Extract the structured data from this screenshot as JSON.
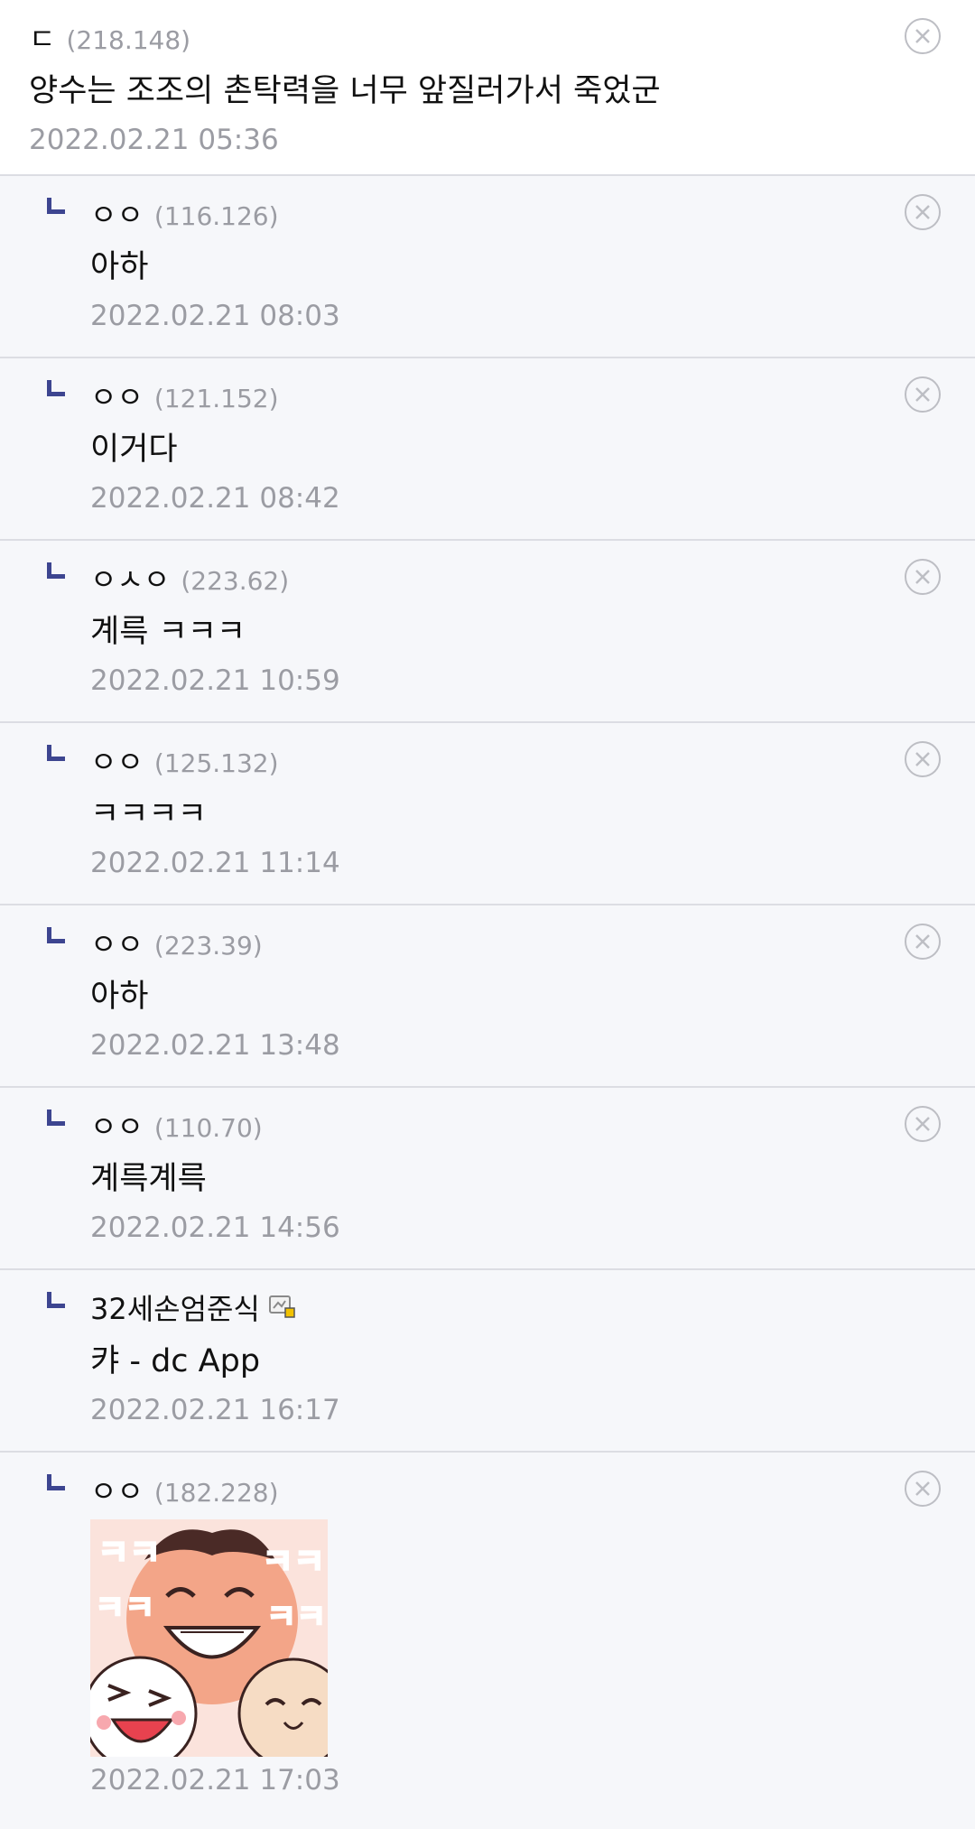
{
  "comments": [
    {
      "nick": "ㄷ",
      "ip": "(218.148)",
      "text": "양수는 조조의 촌탁력을 너무 앞질러가서 죽었군",
      "date": "2022.02.21 05:36"
    },
    {
      "nick": "ㅇㅇ",
      "ip": "(116.126)",
      "text": "아하",
      "date": "2022.02.21 08:03"
    },
    {
      "nick": "ㅇㅇ",
      "ip": "(121.152)",
      "text": "이거다",
      "date": "2022.02.21 08:42"
    },
    {
      "nick": "ㅇㅅㅇ",
      "ip": "(223.62)",
      "text": "계륵 ㅋㅋㅋ",
      "date": "2022.02.21 10:59"
    },
    {
      "nick": "ㅇㅇ",
      "ip": "(125.132)",
      "text": "ㅋㅋㅋㅋ",
      "date": "2022.02.21 11:14"
    },
    {
      "nick": "ㅇㅇ",
      "ip": "(223.39)",
      "text": "아하",
      "date": "2022.02.21 13:48"
    },
    {
      "nick": "ㅇㅇ",
      "ip": "(110.70)",
      "text": "계륵계륵",
      "date": "2022.02.21 14:56"
    },
    {
      "nick": "32세손엄준식",
      "text": "캬 - dc App",
      "date": "2022.02.21 16:17"
    },
    {
      "nick": "ㅇㅇ",
      "ip": "(182.228)",
      "date": "2022.02.21 17:03"
    }
  ],
  "sticker": {
    "text": "ㅋㅋ"
  },
  "colors": {
    "reply_mark": "#3d4590",
    "meta_gray": "#9b9ca3",
    "reply_bg": "#f6f7fa",
    "divider": "#dcdde3"
  },
  "icons": {
    "delete": "close-circle-icon",
    "reply": "reply-arrow-icon",
    "gallog": "gallog-icon"
  }
}
